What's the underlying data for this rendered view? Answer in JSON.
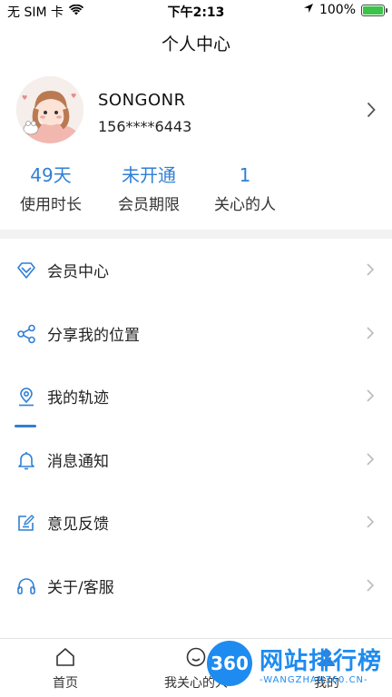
{
  "status_bar": {
    "carrier": "无 SIM 卡",
    "time": "下午2:13",
    "battery_percent": "100%",
    "battery_level": 1.0
  },
  "nav": {
    "title": "个人中心"
  },
  "profile": {
    "username": "SONGONR",
    "phone": "156****6443"
  },
  "stats": [
    {
      "value": "49天",
      "label": "使用时长"
    },
    {
      "value": "未开通",
      "label": "会员期限"
    },
    {
      "value": "1",
      "label": "关心的人"
    }
  ],
  "menu": [
    {
      "label": "会员中心",
      "icon": "diamond-icon"
    },
    {
      "label": "分享我的位置",
      "icon": "share-icon"
    },
    {
      "label": "我的轨迹",
      "icon": "location-pin-icon"
    },
    {
      "label": "消息通知",
      "icon": "bell-icon"
    },
    {
      "label": "意见反馈",
      "icon": "feedback-icon"
    },
    {
      "label": "关于/客服",
      "icon": "headset-icon"
    }
  ],
  "tabs": [
    {
      "label": "首页",
      "icon": "home-icon"
    },
    {
      "label": "我关心的人",
      "icon": "smile-icon"
    },
    {
      "label": "我的",
      "icon": "person-icon"
    }
  ],
  "watermark": {
    "logo_text": "360",
    "title": "网站排行榜",
    "subtitle": "-WANGZHAN360.CN-"
  },
  "colors": {
    "accent": "#2f7fd6",
    "battery": "#3cc34a",
    "watermark": "#1e8bf0"
  }
}
